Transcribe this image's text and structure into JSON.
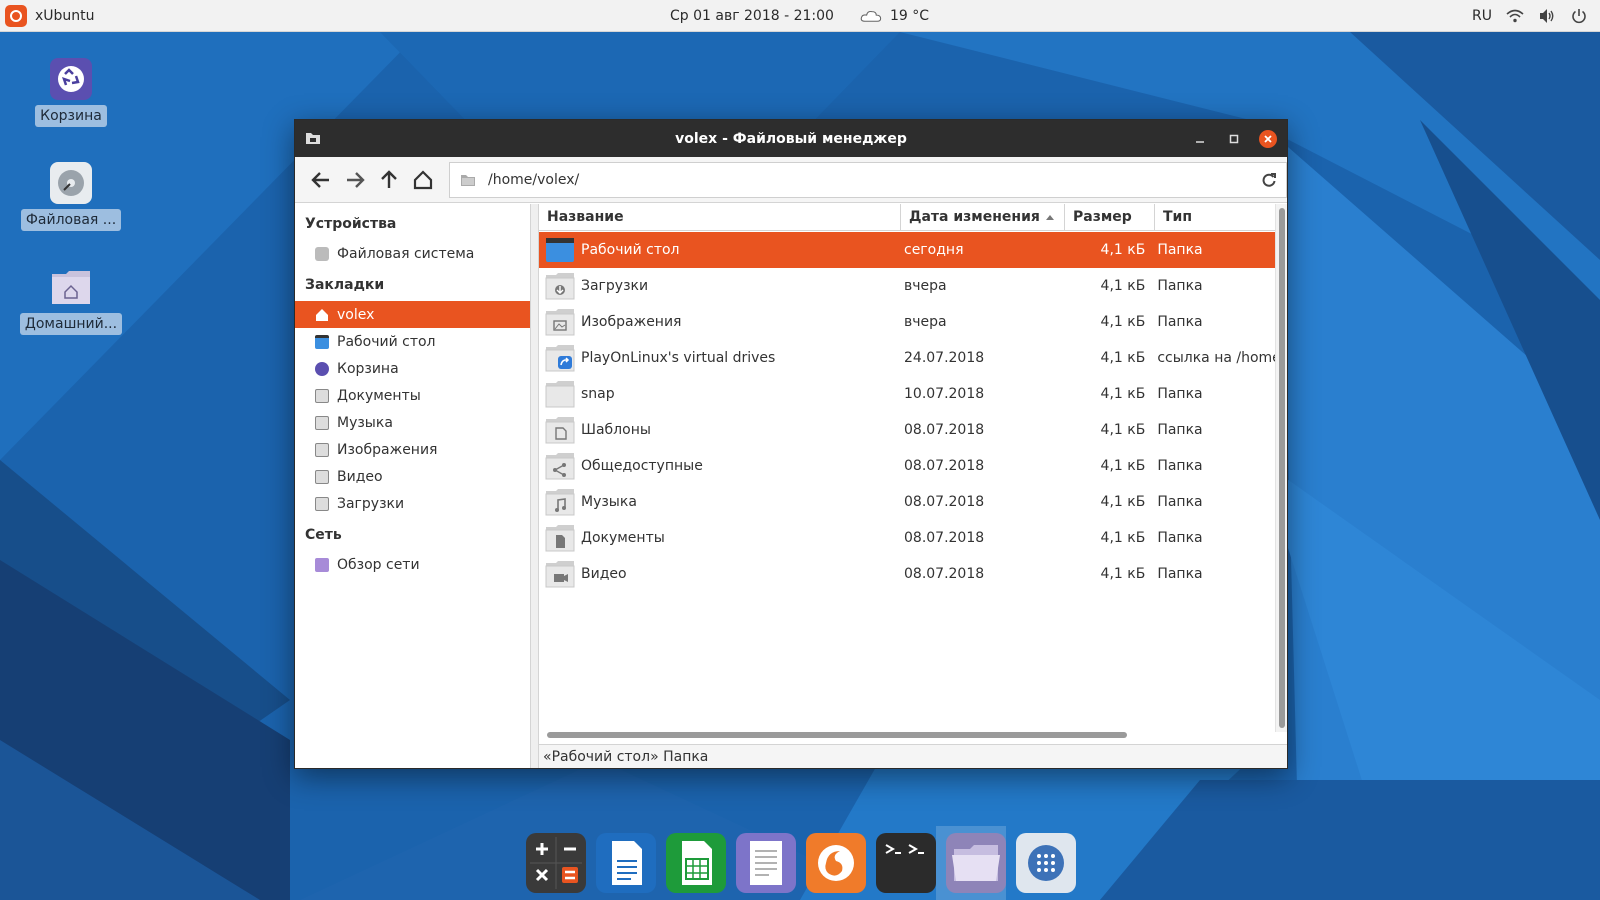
{
  "top_panel": {
    "app_name": "xUbuntu",
    "datetime": "Ср 01 авг 2018 - 21:00",
    "temperature": "19 °C",
    "keyboard_layout": "RU"
  },
  "desktop_icons": [
    {
      "label": "Корзина",
      "icon": "trash-icon"
    },
    {
      "label": "Файловая ...",
      "icon": "disk-icon"
    },
    {
      "label": "Домашний...",
      "icon": "home-folder-icon"
    }
  ],
  "window": {
    "title": "volex - Файловый менеджер",
    "address": "/home/volex/",
    "sidebar": {
      "devices_heading": "Устройства",
      "devices": [
        {
          "label": "Файловая система"
        }
      ],
      "bookmarks_heading": "Закладки",
      "bookmarks": [
        {
          "label": "volex",
          "active": true
        },
        {
          "label": "Рабочий стол"
        },
        {
          "label": "Корзина"
        },
        {
          "label": "Документы"
        },
        {
          "label": "Музыка"
        },
        {
          "label": "Изображения"
        },
        {
          "label": "Видео"
        },
        {
          "label": "Загрузки"
        }
      ],
      "network_heading": "Сеть",
      "network": [
        {
          "label": "Обзор сети"
        }
      ]
    },
    "columns": {
      "name": "Название",
      "date": "Дата изменения",
      "size": "Размер",
      "type": "Тип"
    },
    "files": [
      {
        "name": "Рабочий стол",
        "date": "сегодня",
        "size": "4,1 кБ",
        "type": "Папка",
        "icon": "desktop-folder-icon",
        "selected": true
      },
      {
        "name": "Загрузки",
        "date": "вчера",
        "size": "4,1 кБ",
        "type": "Папка",
        "icon": "downloads-folder-icon"
      },
      {
        "name": "Изображения",
        "date": "вчера",
        "size": "4,1 кБ",
        "type": "Папка",
        "icon": "pictures-folder-icon"
      },
      {
        "name": "PlayOnLinux's virtual drives",
        "date": "24.07.2018",
        "size": "4,1 кБ",
        "type": "ссылка на /home",
        "icon": "link-folder-icon"
      },
      {
        "name": "snap",
        "date": "10.07.2018",
        "size": "4,1 кБ",
        "type": "Папка",
        "icon": "folder-icon"
      },
      {
        "name": "Шаблоны",
        "date": "08.07.2018",
        "size": "4,1 кБ",
        "type": "Папка",
        "icon": "templates-folder-icon"
      },
      {
        "name": "Общедоступные",
        "date": "08.07.2018",
        "size": "4,1 кБ",
        "type": "Папка",
        "icon": "public-folder-icon"
      },
      {
        "name": "Музыка",
        "date": "08.07.2018",
        "size": "4,1 кБ",
        "type": "Папка",
        "icon": "music-folder-icon"
      },
      {
        "name": "Документы",
        "date": "08.07.2018",
        "size": "4,1 кБ",
        "type": "Папка",
        "icon": "documents-folder-icon"
      },
      {
        "name": "Видео",
        "date": "08.07.2018",
        "size": "4,1 кБ",
        "type": "Папка",
        "icon": "video-folder-icon"
      }
    ],
    "status": "«Рабочий стол» Папка"
  },
  "dock": [
    {
      "icon": "calculator-icon"
    },
    {
      "icon": "writer-icon"
    },
    {
      "icon": "spreadsheet-icon"
    },
    {
      "icon": "text-editor-icon"
    },
    {
      "icon": "firefox-icon"
    },
    {
      "icon": "terminal-icon"
    },
    {
      "icon": "file-manager-icon",
      "active": true
    },
    {
      "icon": "app-grid-icon"
    }
  ],
  "colors": {
    "accent": "#e95420",
    "titlebar": "#2d2d2d",
    "desktop_blue": "#1a5fa8"
  }
}
